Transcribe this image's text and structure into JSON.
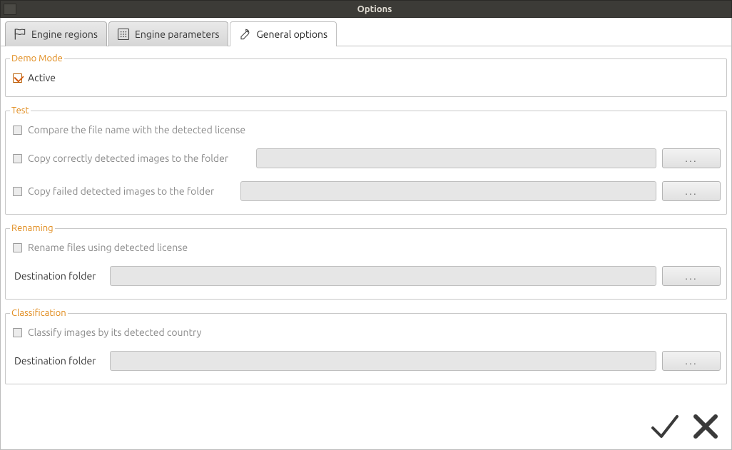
{
  "window": {
    "title": "Options"
  },
  "tabs": {
    "engine_regions": "Engine regions",
    "engine_parameters": "Engine parameters",
    "general_options": "General options"
  },
  "groups": {
    "demo": {
      "legend": "Demo Mode",
      "active_label": "Active",
      "active_checked": true
    },
    "test": {
      "legend": "Test",
      "compare_label": "Compare the file name with the detected license",
      "compare_checked": false,
      "copy_ok_label": "Copy correctly detected images to the folder",
      "copy_ok_checked": false,
      "copy_ok_path": "",
      "copy_fail_label": "Copy failed detected images to the folder",
      "copy_fail_checked": false,
      "copy_fail_path": ""
    },
    "renaming": {
      "legend": "Renaming",
      "rename_label": "Rename files using detected license",
      "rename_checked": false,
      "dest_label": "Destination folder",
      "dest_path": ""
    },
    "classification": {
      "legend": "Classification",
      "classify_label": "Classify images by its detected country",
      "classify_checked": false,
      "dest_label": "Destination folder",
      "dest_path": ""
    }
  },
  "buttons": {
    "browse": "...",
    "ok": "OK",
    "cancel": "Cancel"
  }
}
